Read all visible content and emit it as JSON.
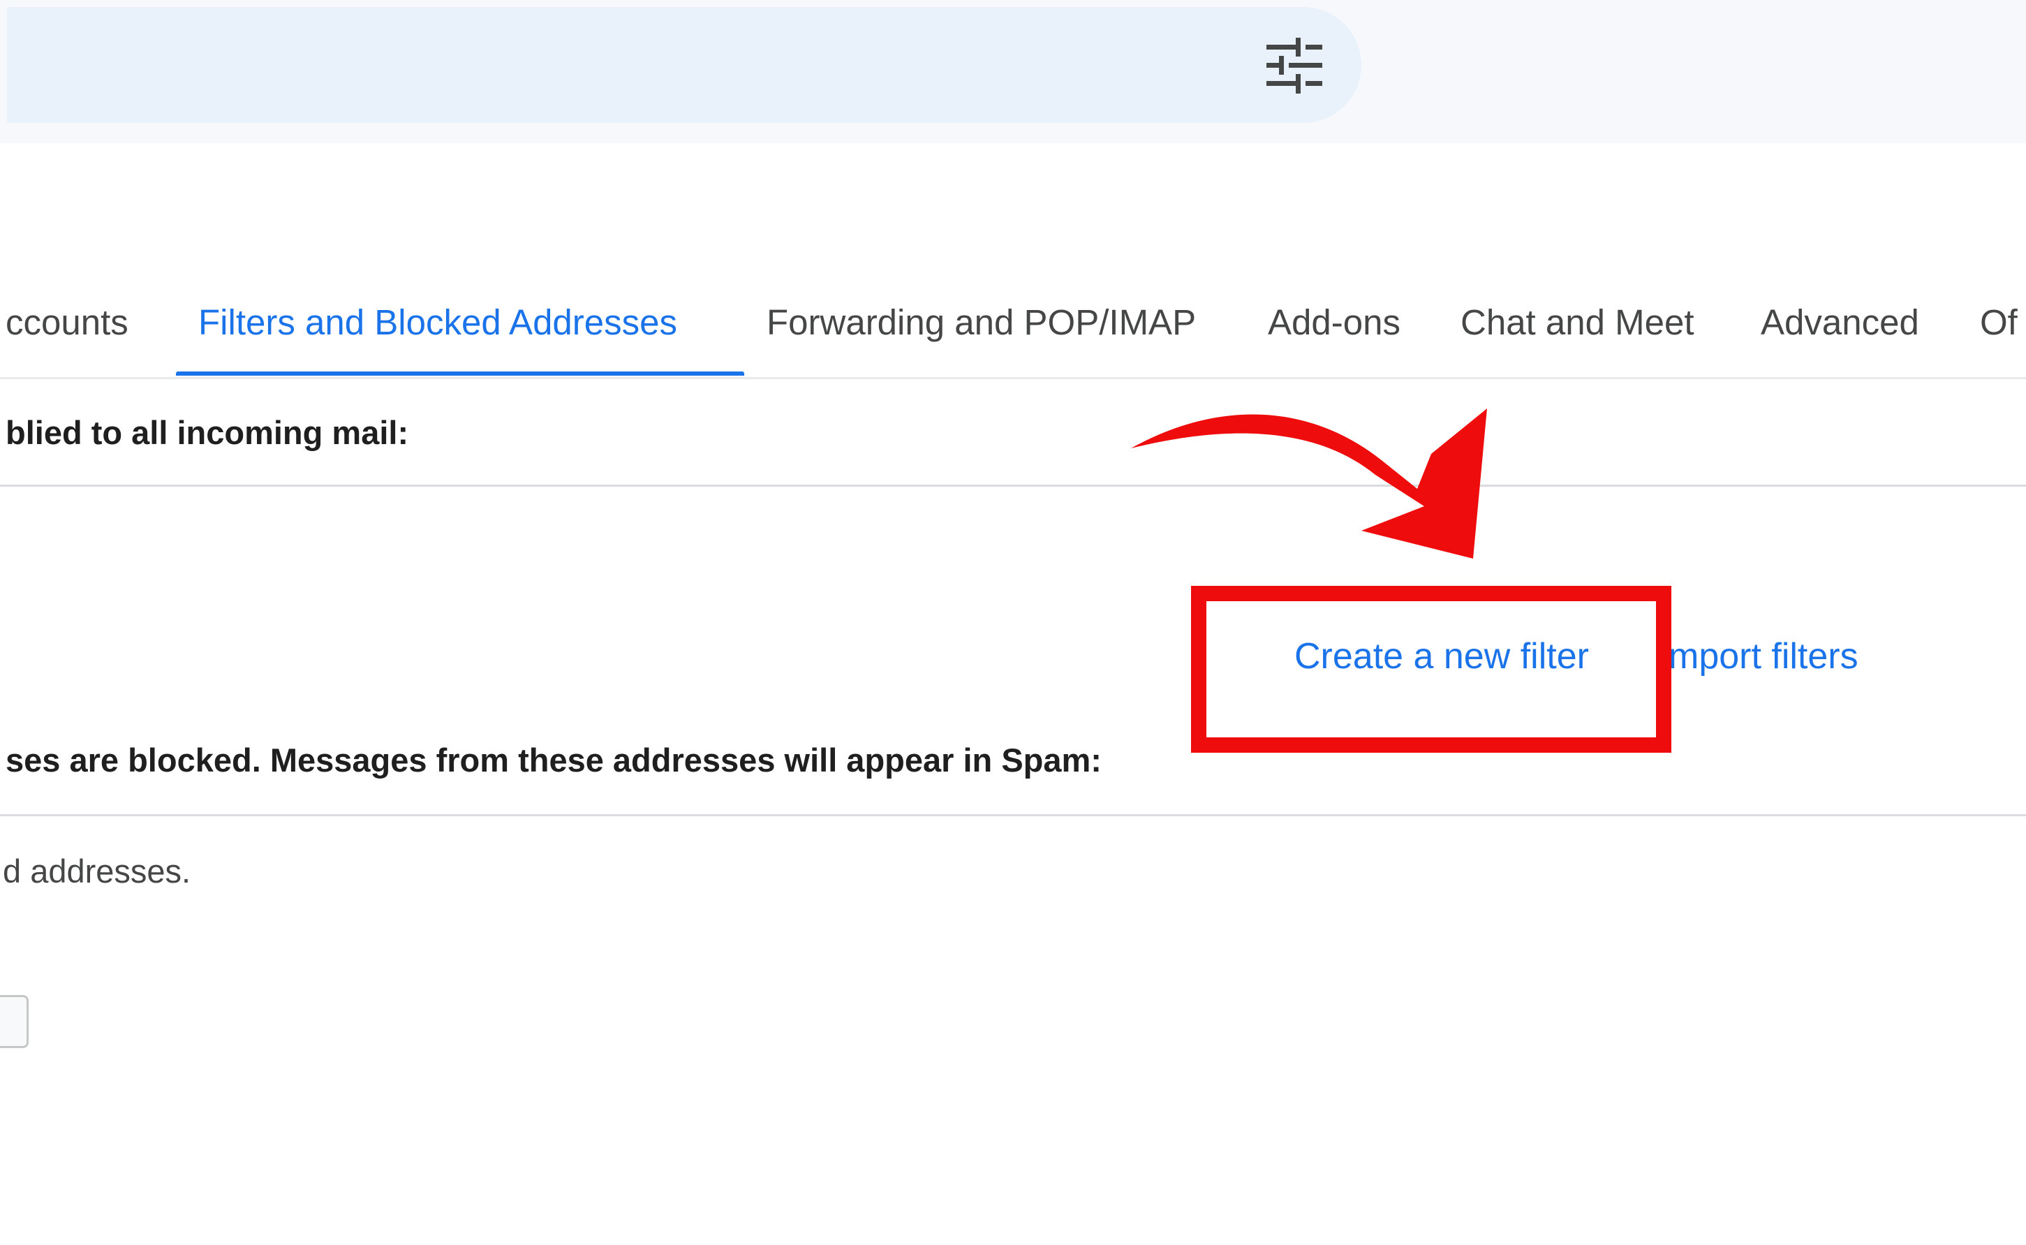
{
  "header": {
    "search_options_icon": "tune-icon"
  },
  "tabs": [
    {
      "label": "ccounts",
      "active": false
    },
    {
      "label": "Filters and Blocked Addresses",
      "active": true
    },
    {
      "label": "Forwarding and POP/IMAP",
      "active": false
    },
    {
      "label": "Add-ons",
      "active": false
    },
    {
      "label": "Chat and Meet",
      "active": false
    },
    {
      "label": "Advanced",
      "active": false
    },
    {
      "label": "Of",
      "active": false
    }
  ],
  "filters_section": {
    "heading": "blied to all incoming mail:",
    "create_filter_link": "Create a new filter",
    "import_filters_link": "mport filters"
  },
  "blocked_section": {
    "heading": "ses are blocked. Messages from these addresses will appear in Spam:",
    "empty_text": "d addresses."
  },
  "annotation": {
    "highlight_color": "#ee0c0c",
    "arrow_icon": "curved-arrow-icon"
  },
  "colors": {
    "accent": "#1a73e8",
    "search_bar": "#e9f1fb",
    "header_bg": "#f6f8fc"
  }
}
